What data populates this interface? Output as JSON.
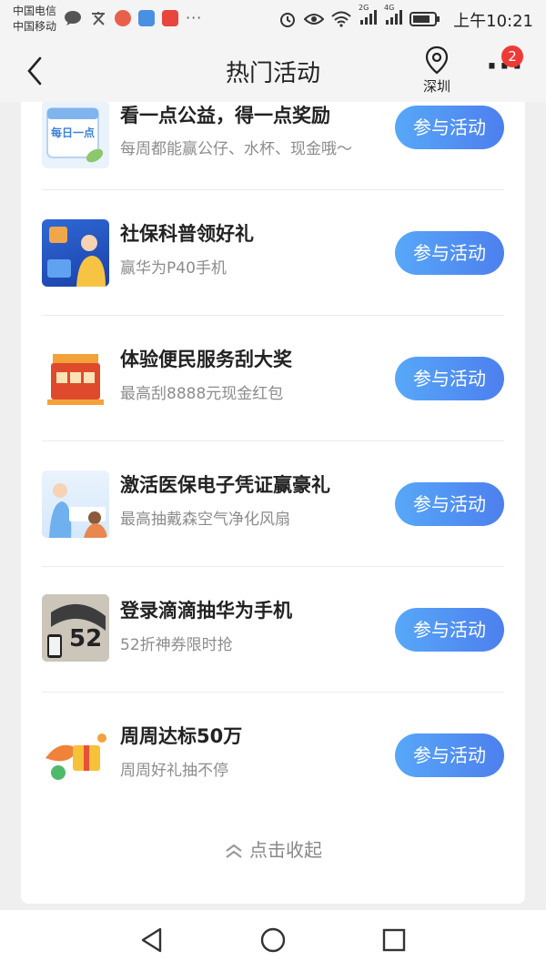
{
  "status_bar": {
    "carrier_1": "中国电信",
    "carrier_2": "中国移动",
    "signal_2g": "2G",
    "signal_4g": "4G",
    "time": "上午10:21",
    "icons": [
      "message-icon",
      "translate-icon",
      "app-icon",
      "app-icon",
      "app-icon",
      "more-icon",
      "alarm-icon",
      "eye-icon",
      "wifi-icon",
      "signal-icon",
      "battery-icon"
    ]
  },
  "nav": {
    "title": "热门活动",
    "location": "深圳",
    "badge_count": "2"
  },
  "activities": [
    {
      "title": "看一点公益，得一点奖励",
      "subtitle": "每周都能赢公仔、水杯、现金哦～",
      "button": "参与活动",
      "thumb_text": "每日一点"
    },
    {
      "title": "社保科普领好礼",
      "subtitle": "赢华为P40手机",
      "button": "参与活动"
    },
    {
      "title": "体验便民服务刮大奖",
      "subtitle": "最高刮8888元现金红包",
      "button": "参与活动"
    },
    {
      "title": "激活医保电子凭证赢豪礼",
      "subtitle": "最高抽戴森空气净化风扇",
      "button": "参与活动"
    },
    {
      "title": "登录滴滴抽华为手机",
      "subtitle": "52折神券限时抢",
      "button": "参与活动",
      "thumb_text": "52"
    },
    {
      "title": "周周达标50万",
      "subtitle": "周周好礼抽不停",
      "button": "参与活动"
    }
  ],
  "collapse_label": "点击收起",
  "colors": {
    "accent_start": "#57a8f8",
    "accent_end": "#4d7fee",
    "badge": "#ee3a36"
  }
}
